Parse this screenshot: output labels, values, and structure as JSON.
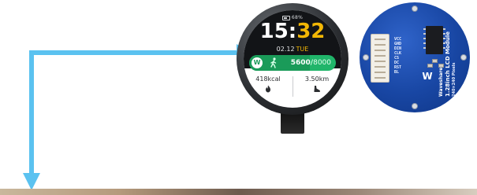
{
  "display": {
    "battery": "68%",
    "clock": {
      "hours": "15",
      "separator": ":",
      "minutes": "32"
    },
    "date": {
      "day": "02.12",
      "weekday": "TUE"
    },
    "steps": {
      "logo": "W",
      "current": "5600",
      "sep": "/",
      "goal": "8000",
      "progress": 0.7
    },
    "stats": [
      {
        "value": "418kcal",
        "icon": "fire-icon"
      },
      {
        "value": "3.50km",
        "icon": "shoe-icon"
      }
    ]
  },
  "board": {
    "pins": [
      "VCC",
      "GND",
      "DIN",
      "CLK",
      "CS",
      "DC",
      "RST",
      "BL"
    ],
    "brand": "Waveshare",
    "model": "1.28inch LCD Module",
    "resolution": "240×240 Pixels"
  },
  "colors": {
    "arrow": "#5bc2f0",
    "accent": "#f2b705",
    "step_green": "#20b56a",
    "pcb_blue": "#1846a3"
  }
}
